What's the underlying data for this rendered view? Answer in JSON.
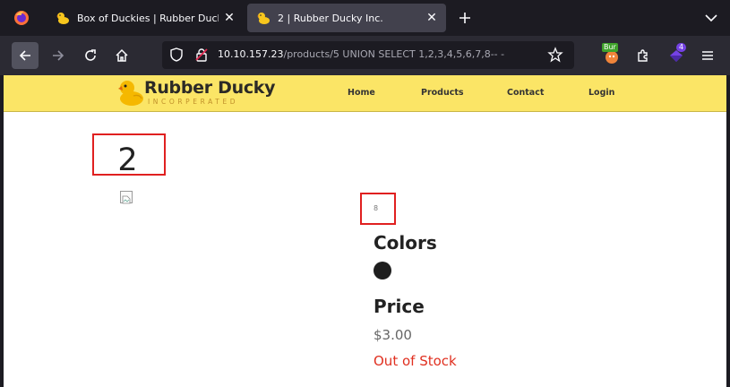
{
  "browser": {
    "tabs": [
      {
        "title": "Box of Duckies | Rubber Ducky Inc.",
        "active": false
      },
      {
        "title": "2 | Rubber Ducky Inc.",
        "active": true
      }
    ],
    "url": {
      "host": "10.10.157.23",
      "path": "/products/5 UNION SELECT 1,2,3,4,5,6,7,8-- -"
    },
    "extensions": {
      "burp_label": "Bur",
      "badge_count": "4"
    },
    "colors": {
      "tabbar_bg": "#1c1b22",
      "active_tab_bg": "#42414d",
      "toolbar_bg": "#2b2a33"
    }
  },
  "site": {
    "logo": {
      "name": "Rubber Ducky",
      "tagline": "INCORPERATED"
    },
    "nav": [
      {
        "label": "Home"
      },
      {
        "label": "Products"
      },
      {
        "label": "Contact"
      },
      {
        "label": "Login"
      }
    ],
    "colors": {
      "header_bg": "#fbe566",
      "highlight_box": "#e02020",
      "out_of_stock": "#e03020"
    }
  },
  "product": {
    "name": "2",
    "description": "8",
    "colors_heading": "Colors",
    "color_swatch": "#1e1e1e",
    "price_heading": "Price",
    "price": "$3.00",
    "stock_status": "Out of Stock"
  }
}
